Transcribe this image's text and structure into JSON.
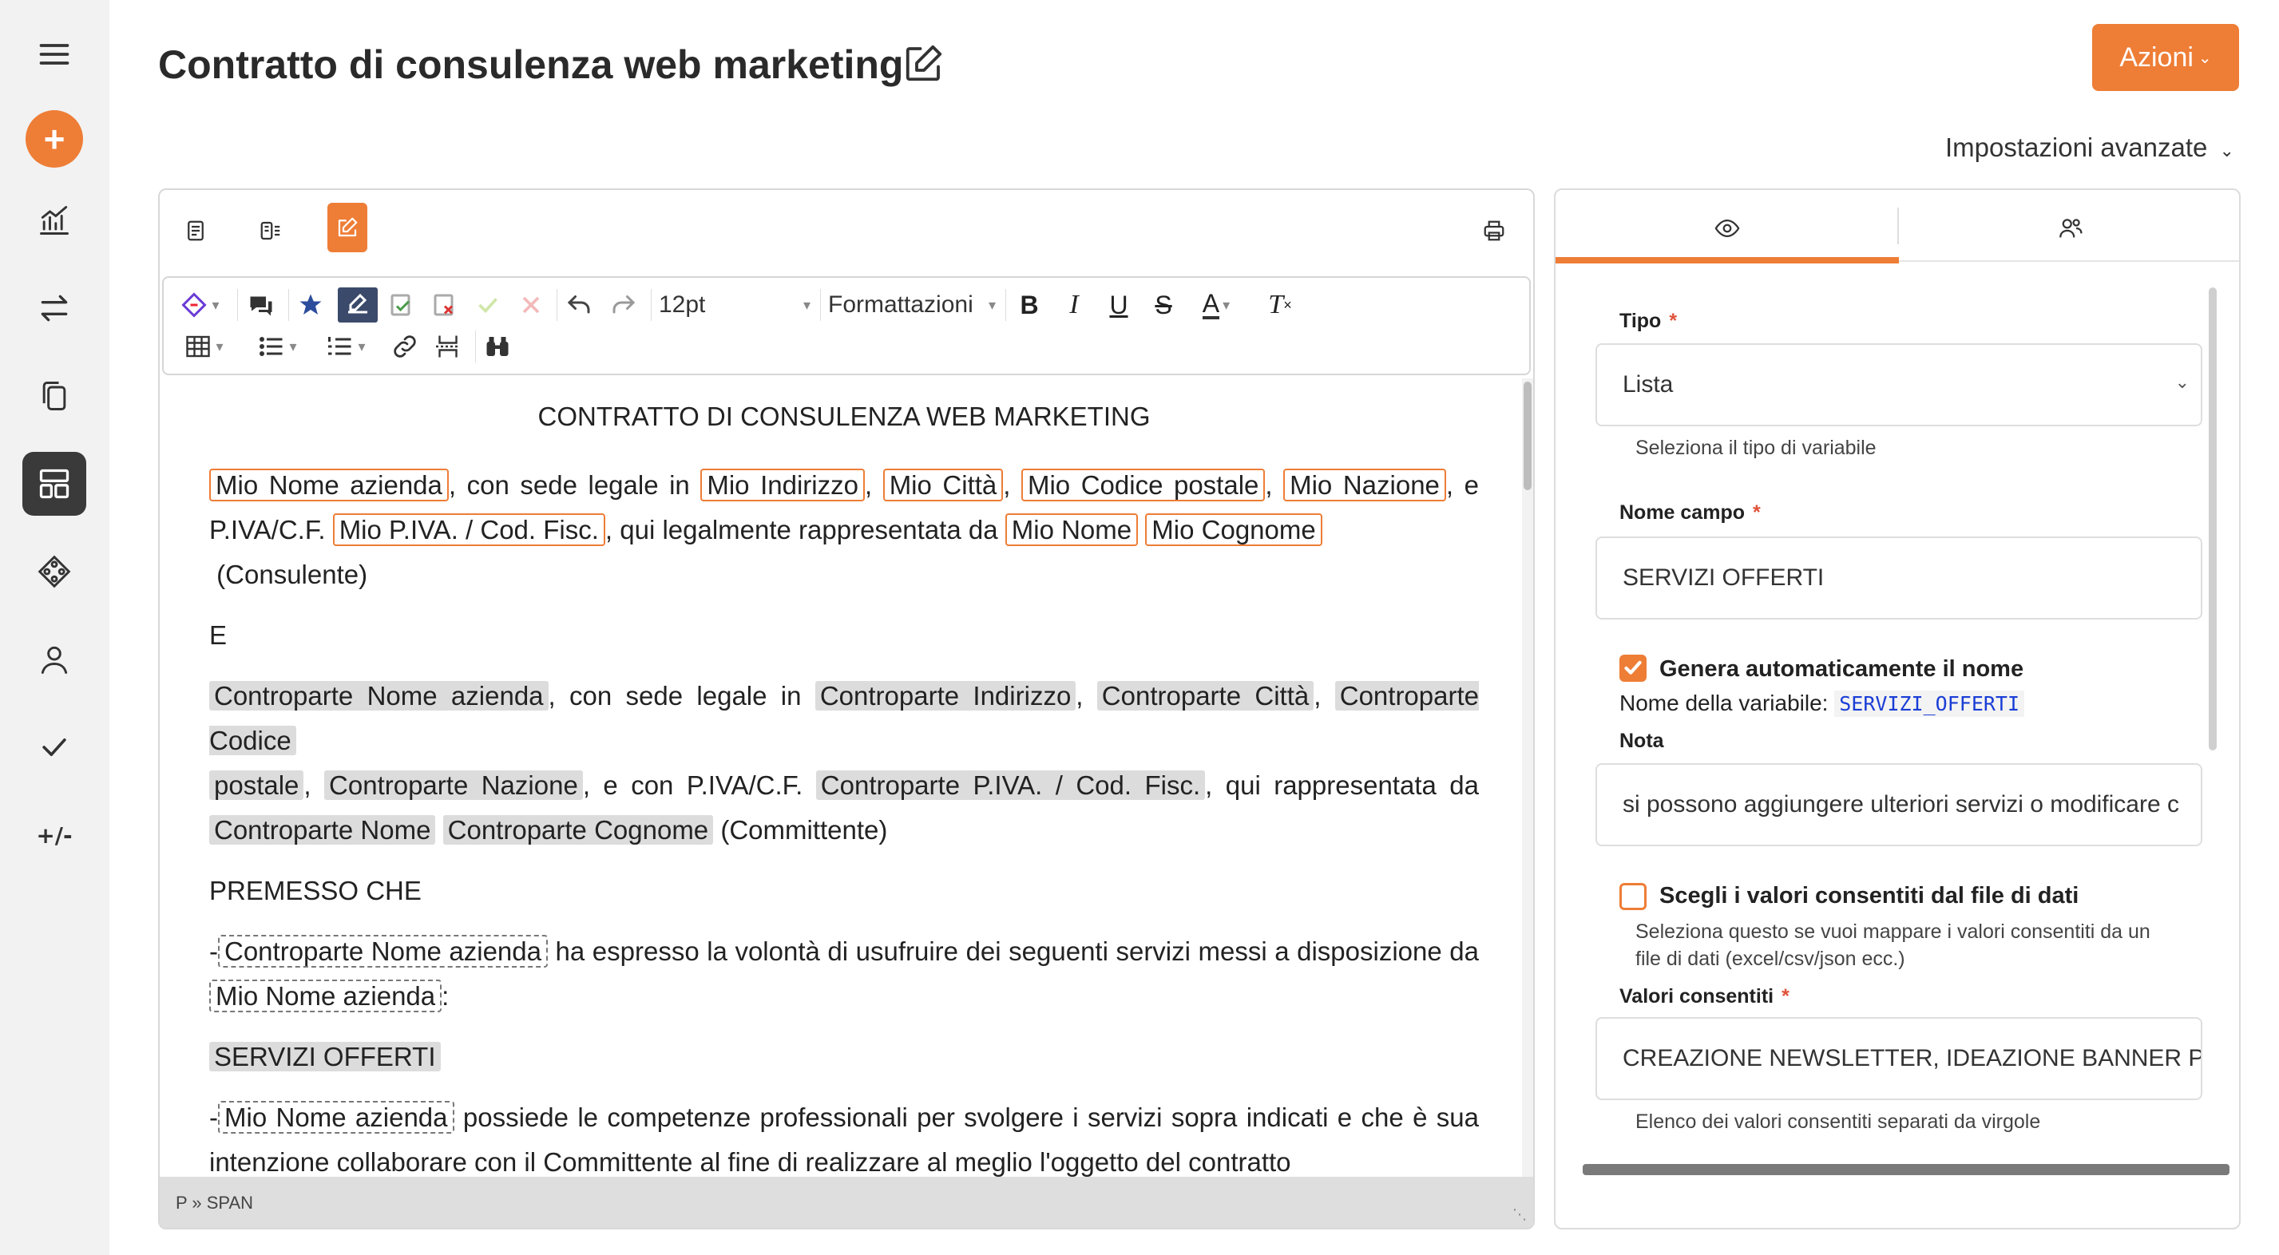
{
  "sidebar": {
    "items": [
      {
        "name": "menu-icon"
      },
      {
        "name": "add-icon"
      },
      {
        "name": "analytics-icon"
      },
      {
        "name": "transfer-icon"
      },
      {
        "name": "documents-icon"
      },
      {
        "name": "dashboard-icon"
      },
      {
        "name": "integrations-icon"
      },
      {
        "name": "user-icon"
      },
      {
        "name": "check-icon"
      },
      {
        "name": "variables-icon"
      }
    ],
    "plus_symbol": "+",
    "diff_label": "+/-"
  },
  "header": {
    "title": "Contratto di consulenza web marketing",
    "actions_label": "Azioni",
    "advanced_settings": "Impostazioni avanzate"
  },
  "toolbar": {
    "font_size": "12pt",
    "format_label": "Formattazioni"
  },
  "document": {
    "heading": "CONTRATTO DI CONSULENZA WEB MARKETING",
    "p1": {
      "mio_nome_azienda": "Mio Nome azienda",
      "t1": ", con sede legale in",
      "mio_indirizzo": "Mio Indirizzo",
      "mio_citta": "Mio Città",
      "mio_cap": "Mio Codice postale",
      "mio_nazione": "Mio Nazione",
      "t2": ", e",
      "t3": "P.IVA/C.F.",
      "mio_piva": "Mio P.IVA. / Cod. Fisc.",
      "t4": ", qui legalmente rappresentata da",
      "mio_nome": "Mio Nome",
      "mio_cognome": "Mio Cognome",
      "t5": "(Consulente)"
    },
    "e_label": "E",
    "p2": {
      "cp_nome_azienda": "Controparte Nome azienda",
      "t1": ", con sede legale in",
      "cp_indirizzo": "Controparte Indirizzo",
      "cp_citta": "Controparte Città",
      "cp_cap_a": "Controparte Codice",
      "cp_cap_b": "postale",
      "cp_nazione": "Controparte Nazione",
      "t2": ", e con P.IVA/C.F.",
      "cp_piva": "Controparte P.IVA. / Cod. Fisc.",
      "t3": ", qui rappresentata da",
      "cp_nome": "Controparte Nome",
      "cp_cognome": "Controparte Cognome",
      "t4": "(Committente)"
    },
    "premesso": "PREMESSO CHE",
    "p3": {
      "dash": "-",
      "cp_nome_azienda": "Controparte Nome azienda",
      "t1": "ha espresso la volontà di usufruire dei seguenti servizi messi a disposizione da",
      "mio_nome_azienda": "Mio Nome azienda",
      "colon": ":"
    },
    "servizi": "SERVIZI OFFERTI",
    "p4": {
      "dash": "-",
      "mio_nome_azienda": "Mio Nome azienda",
      "t1": "possiede le competenze professionali per svolgere i servizi sopra indicati  e che è sua",
      "t2": "intenzione collaborare con il Committente al fine di realizzare al meglio l'oggetto del contratto"
    }
  },
  "status_bar": "P » SPAN",
  "panel": {
    "tipo_label": "Tipo",
    "tipo_value": "Lista",
    "tipo_help": "Seleziona il tipo di variabile",
    "nome_label": "Nome campo",
    "nome_value": "SERVIZI OFFERTI",
    "auto_name_label": "Genera automaticamente il nome",
    "auto_name_checked": true,
    "var_name_prefix": "Nome della variabile:",
    "var_name": "SERVIZI_OFFERTI",
    "nota_label": "Nota",
    "nota_value": "si possono aggiungere ulteriori servizi o modificare c",
    "datafile_label": "Scegli i valori consentiti dal file di dati",
    "datafile_checked": false,
    "datafile_help_1": "Seleziona questo se vuoi mappare i valori consentiti da un",
    "datafile_help_2": "file di dati (excel/csv/json ecc.)",
    "valori_label": "Valori consentiti",
    "valori_value": "CREAZIONE NEWSLETTER, IDEAZIONE BANNER PUI",
    "valori_help": "Elenco dei valori consentiti separati da virgole"
  },
  "colors": {
    "accent": "#ee7d36",
    "sidebar_bg": "#f2f2f2",
    "active_item": "#3a3a3a",
    "required": "#e0523b",
    "variable_code": "#1a3dd6"
  }
}
